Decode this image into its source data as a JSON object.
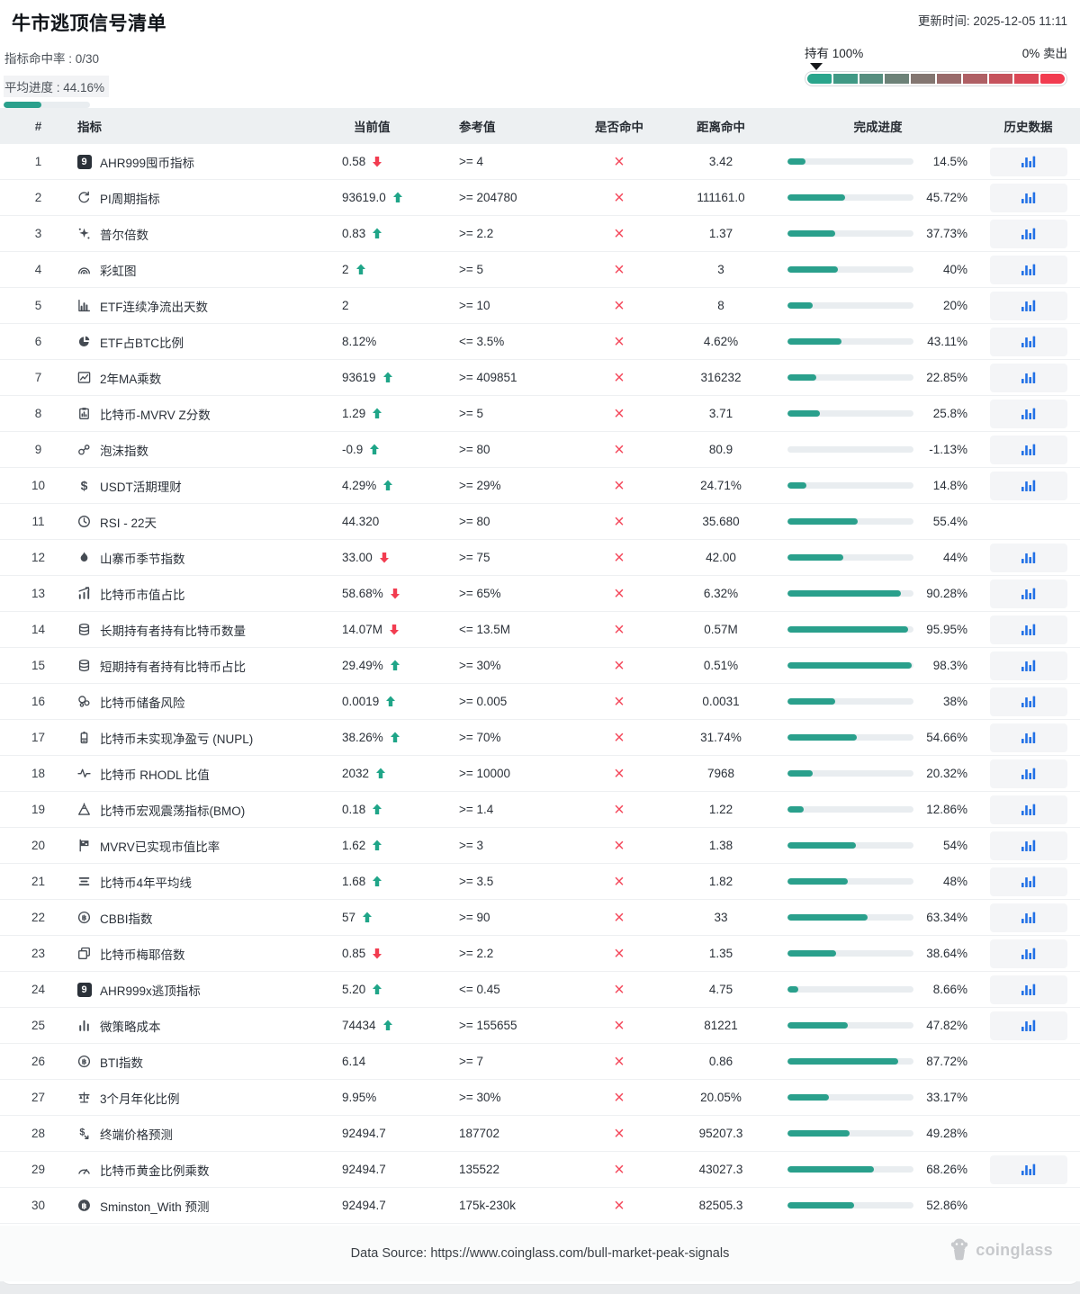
{
  "header": {
    "title": "牛市逃顶信号清单",
    "updated": "更新时间: 2025-12-05 11:11",
    "hit_rate_label": "指标命中率 : 0/30",
    "avg_progress_label": "平均进度 : 44.16%",
    "avg_progress_pct": 44.16,
    "hold_label": "持有 100%",
    "sell_label": "0% 卖出",
    "gauge_marker_pct": 2,
    "gauge_colors": [
      "#2aa58c",
      "#409985",
      "#568e7f",
      "#6d8278",
      "#837671",
      "#996b6b",
      "#af5f64",
      "#c6535d",
      "#dc4857",
      "#f23c50"
    ]
  },
  "colors": {
    "teal": "#2aa08c",
    "red": "#f23c50",
    "miss_red": "#f4495c",
    "history_blue": "#2271e6"
  },
  "table": {
    "columns": [
      "#",
      "指标",
      "当前值",
      "参考值",
      "是否命中",
      "距离命中",
      "完成进度",
      "历史数据"
    ],
    "miss_glyph": "×",
    "rows": [
      {
        "num": "1",
        "icon": "badge9",
        "name": "AHR999囤币指标",
        "current": "0.58",
        "trend": "down",
        "ref": ">= 4",
        "distance": "3.42",
        "progress_label": "14.5%",
        "progress_pct": 14.5,
        "history": true
      },
      {
        "num": "2",
        "icon": "refresh",
        "name": "PI周期指标",
        "current": "93619.0",
        "trend": "up",
        "ref": ">= 204780",
        "distance": "111161.0",
        "progress_label": "45.72%",
        "progress_pct": 45.72,
        "history": true
      },
      {
        "num": "3",
        "icon": "sparkle",
        "name": "普尔倍数",
        "current": "0.83",
        "trend": "up",
        "ref": ">= 2.2",
        "distance": "1.37",
        "progress_label": "37.73%",
        "progress_pct": 37.73,
        "history": true
      },
      {
        "num": "4",
        "icon": "rainbow",
        "name": "彩虹图",
        "current": "2",
        "trend": "up",
        "ref": ">= 5",
        "distance": "3",
        "progress_label": "40%",
        "progress_pct": 40,
        "history": true
      },
      {
        "num": "5",
        "icon": "barchart",
        "name": "ETF连续净流出天数",
        "current": "2",
        "trend": "none",
        "ref": ">= 10",
        "distance": "8",
        "progress_label": "20%",
        "progress_pct": 20,
        "history": true
      },
      {
        "num": "6",
        "icon": "piechart",
        "name": "ETF占BTC比例",
        "current": "8.12%",
        "trend": "none",
        "ref": "<= 3.5%",
        "distance": "4.62%",
        "progress_label": "43.11%",
        "progress_pct": 43.11,
        "history": true
      },
      {
        "num": "7",
        "icon": "linechart",
        "name": "2年MA乘数",
        "current": "93619",
        "trend": "up",
        "ref": ">= 409851",
        "distance": "316232",
        "progress_label": "22.85%",
        "progress_pct": 22.85,
        "history": true
      },
      {
        "num": "8",
        "icon": "clipboard",
        "name": "比特币-MVRV Z分数",
        "current": "1.29",
        "trend": "up",
        "ref": ">= 5",
        "distance": "3.71",
        "progress_label": "25.8%",
        "progress_pct": 25.8,
        "history": true
      },
      {
        "num": "9",
        "icon": "bubbles",
        "name": "泡沫指数",
        "current": "-0.9",
        "trend": "up",
        "ref": ">= 80",
        "distance": "80.9",
        "progress_label": "-1.13%",
        "progress_pct": 0,
        "history": true
      },
      {
        "num": "10",
        "icon": "dollar",
        "name": "USDT活期理财",
        "current": "4.29%",
        "trend": "up",
        "ref": ">= 29%",
        "distance": "24.71%",
        "progress_label": "14.8%",
        "progress_pct": 14.8,
        "history": true
      },
      {
        "num": "11",
        "icon": "clock",
        "name": "RSI - 22天",
        "current": "44.320",
        "trend": "none",
        "ref": ">= 80",
        "distance": "35.680",
        "progress_label": "55.4%",
        "progress_pct": 55.4,
        "history": false
      },
      {
        "num": "12",
        "icon": "fire",
        "name": "山寨币季节指数",
        "current": "33.00",
        "trend": "down",
        "ref": ">= 75",
        "distance": "42.00",
        "progress_label": "44%",
        "progress_pct": 44,
        "history": true
      },
      {
        "num": "13",
        "icon": "growth",
        "name": "比特币市值占比",
        "current": "58.68%",
        "trend": "down",
        "ref": ">= 65%",
        "distance": "6.32%",
        "progress_label": "90.28%",
        "progress_pct": 90.28,
        "history": true
      },
      {
        "num": "14",
        "icon": "database",
        "name": "长期持有者持有比特币数量",
        "current": "14.07M",
        "trend": "down",
        "ref": "<= 13.5M",
        "distance": "0.57M",
        "progress_label": "95.95%",
        "progress_pct": 95.95,
        "history": true
      },
      {
        "num": "15",
        "icon": "database",
        "name": "短期持有者持有比特币占比",
        "current": "29.49%",
        "trend": "up",
        "ref": ">= 30%",
        "distance": "0.51%",
        "progress_label": "98.3%",
        "progress_pct": 98.3,
        "history": true
      },
      {
        "num": "16",
        "icon": "cluster",
        "name": "比特币储备风险",
        "current": "0.0019",
        "trend": "up",
        "ref": ">= 0.005",
        "distance": "0.0031",
        "progress_label": "38%",
        "progress_pct": 38,
        "history": true
      },
      {
        "num": "17",
        "icon": "battery",
        "name": "比特币未实现净盈亏 (NUPL)",
        "current": "38.26%",
        "trend": "up",
        "ref": ">= 70%",
        "distance": "31.74%",
        "progress_label": "54.66%",
        "progress_pct": 54.66,
        "history": true
      },
      {
        "num": "18",
        "icon": "pulse",
        "name": "比特币 RHODL 比值",
        "current": "2032",
        "trend": "up",
        "ref": ">= 10000",
        "distance": "7968",
        "progress_label": "20.32%",
        "progress_pct": 20.32,
        "history": true
      },
      {
        "num": "19",
        "icon": "volcano",
        "name": "比特币宏观震荡指标(BMO)",
        "current": "0.18",
        "trend": "up",
        "ref": ">= 1.4",
        "distance": "1.22",
        "progress_label": "12.86%",
        "progress_pct": 12.86,
        "history": true
      },
      {
        "num": "20",
        "icon": "flag",
        "name": "MVRV已实现市值比率",
        "current": "1.62",
        "trend": "up",
        "ref": ">= 3",
        "distance": "1.38",
        "progress_label": "54%",
        "progress_pct": 54,
        "history": true
      },
      {
        "num": "21",
        "icon": "lines",
        "name": "比特币4年平均线",
        "current": "1.68",
        "trend": "up",
        "ref": ">= 3.5",
        "distance": "1.82",
        "progress_label": "48%",
        "progress_pct": 48,
        "history": true
      },
      {
        "num": "22",
        "icon": "btc",
        "name": "CBBI指数",
        "current": "57",
        "trend": "up",
        "ref": ">= 90",
        "distance": "33",
        "progress_label": "63.34%",
        "progress_pct": 63.34,
        "history": true
      },
      {
        "num": "23",
        "icon": "copy",
        "name": "比特币梅耶倍数",
        "current": "0.85",
        "trend": "down",
        "ref": ">= 2.2",
        "distance": "1.35",
        "progress_label": "38.64%",
        "progress_pct": 38.64,
        "history": true
      },
      {
        "num": "24",
        "icon": "badge9",
        "name": "AHR999x逃顶指标",
        "current": "5.20",
        "trend": "up",
        "ref": "<= 0.45",
        "distance": "4.75",
        "progress_label": "8.66%",
        "progress_pct": 8.66,
        "history": true
      },
      {
        "num": "25",
        "icon": "minibars",
        "name": "微策略成本",
        "current": "74434",
        "trend": "up",
        "ref": ">= 155655",
        "distance": "81221",
        "progress_label": "47.82%",
        "progress_pct": 47.82,
        "history": true
      },
      {
        "num": "26",
        "icon": "btc",
        "name": "BTI指数",
        "current": "6.14",
        "trend": "none",
        "ref": ">= 7",
        "distance": "0.86",
        "progress_label": "87.72%",
        "progress_pct": 87.72,
        "history": false
      },
      {
        "num": "27",
        "icon": "scale",
        "name": "3个月年化比例",
        "current": "9.95%",
        "trend": "none",
        "ref": ">= 30%",
        "distance": "20.05%",
        "progress_label": "33.17%",
        "progress_pct": 33.17,
        "history": false
      },
      {
        "num": "28",
        "icon": "dollartrend",
        "name": "终端价格预测",
        "current": "92494.7",
        "trend": "none",
        "ref": "187702",
        "distance": "95207.3",
        "progress_label": "49.28%",
        "progress_pct": 49.28,
        "history": false
      },
      {
        "num": "29",
        "icon": "speedo",
        "name": "比特币黄金比例乘数",
        "current": "92494.7",
        "trend": "none",
        "ref": "135522",
        "distance": "43027.3",
        "progress_label": "68.26%",
        "progress_pct": 68.26,
        "history": true
      },
      {
        "num": "30",
        "icon": "btcfilled",
        "name": "Sminston_With 预测",
        "current": "92494.7",
        "trend": "none",
        "ref": "175k-230k",
        "distance": "82505.3",
        "progress_label": "52.86%",
        "progress_pct": 52.86,
        "history": false
      }
    ]
  },
  "footer": {
    "source": "Data Source: https://www.coinglass.com/bull-market-peak-signals",
    "brand": "coinglass"
  }
}
